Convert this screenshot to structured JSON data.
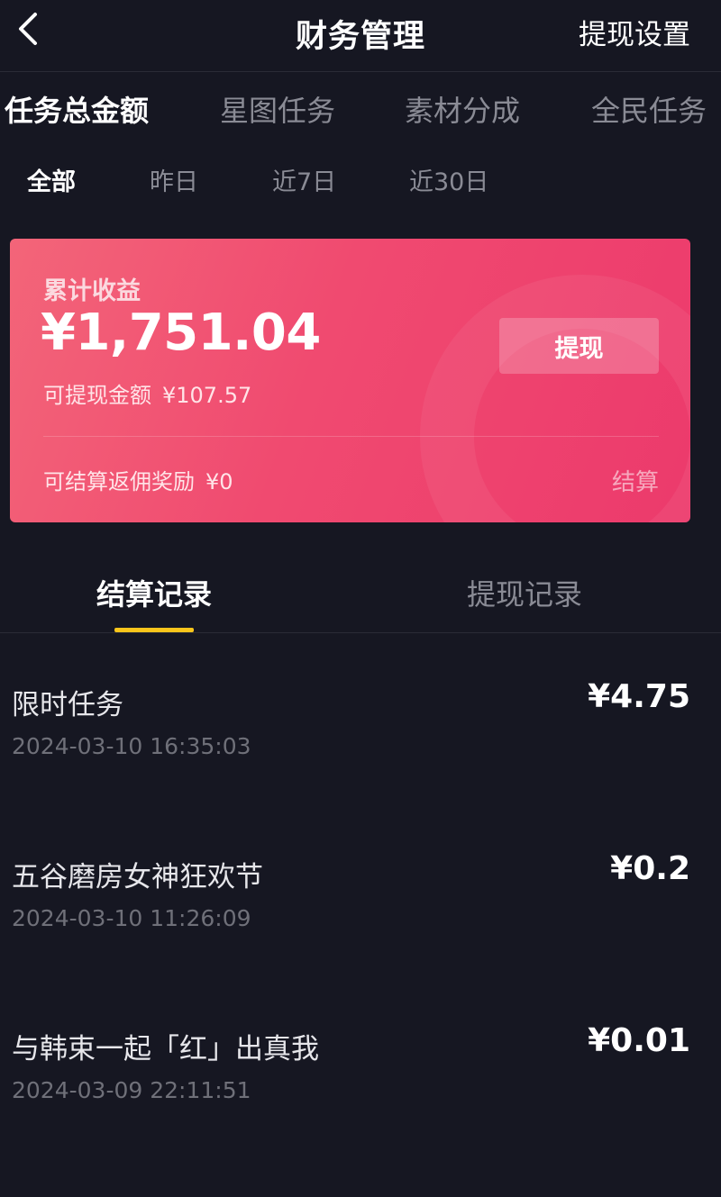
{
  "header": {
    "title": "财务管理",
    "right_link": "提现设置"
  },
  "category_tabs": [
    {
      "label": "任务总金额",
      "active": true
    },
    {
      "label": "星图任务",
      "active": false
    },
    {
      "label": "素材分成",
      "active": false
    },
    {
      "label": "全民任务",
      "active": false
    }
  ],
  "time_tabs": [
    {
      "label": "全部",
      "active": true
    },
    {
      "label": "昨日",
      "active": false
    },
    {
      "label": "近7日",
      "active": false
    },
    {
      "label": "近30日",
      "active": false
    }
  ],
  "card": {
    "label": "累计收益",
    "total": "¥1,751.04",
    "available_label": "可提现金额",
    "available_value": "¥107.57",
    "withdraw_button": "提现",
    "rebate_label": "可结算返佣奖励",
    "rebate_value": "¥0",
    "settle_link": "结算",
    "colors": {
      "gradient_start": "#f36579",
      "gradient_end": "#ec3a6c"
    }
  },
  "record_tabs": [
    {
      "label": "结算记录",
      "active": true
    },
    {
      "label": "提现记录",
      "active": false
    }
  ],
  "records": [
    {
      "title": "限时任务",
      "time": "2024-03-10 16:35:03",
      "amount": "¥4.75"
    },
    {
      "title": "五谷磨房女神狂欢节",
      "time": "2024-03-10 11:26:09",
      "amount": "¥0.2"
    },
    {
      "title": "与韩束一起「红」出真我",
      "time": "2024-03-09 22:11:51",
      "amount": "¥0.01"
    }
  ],
  "icons": {
    "back": "chevron-left-icon"
  },
  "colors": {
    "background": "#161722",
    "accent": "#f9c51b"
  }
}
